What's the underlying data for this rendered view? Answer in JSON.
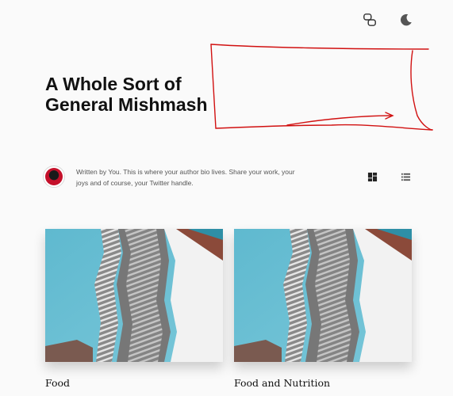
{
  "header": {
    "theme_icons": [
      {
        "name": "link-icon"
      },
      {
        "name": "moon-icon"
      }
    ]
  },
  "blog": {
    "title_line1": "A Whole Sort of",
    "title_line2": "General Mishmash"
  },
  "author": {
    "bio": "Written by You. This is where your author bio lives. Share your work, your joys and of course, your Twitter handle."
  },
  "view_toggle": {
    "options": [
      "grid-view-icon",
      "list-view-icon"
    ],
    "selected": "grid-view-icon"
  },
  "posts": [
    {
      "title": "Food"
    },
    {
      "title": "Food and Nutrition"
    }
  ],
  "colors": {
    "scribble": "#d11010",
    "sky": "#5fb3c9",
    "background": "#fafafa"
  }
}
